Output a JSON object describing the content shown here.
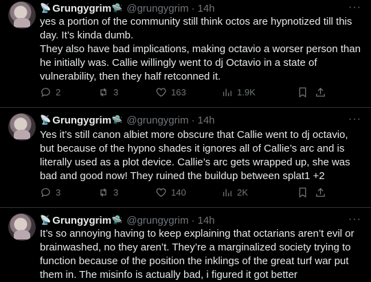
{
  "tweets": [
    {
      "emoji": "📡",
      "name": "Grungygrim",
      "badge": "🛸",
      "handle": "@grungygrim",
      "sep": "·",
      "time": "14h",
      "more": "···",
      "text": "yes a portion of the community still think octos are hypnotized till this day. It’s kinda dumb.\nThey also have bad implications, making octavio a worser person than he initially was. Callie willingly went to dj Octavio in a state of vulnerability, then they half retconned it.",
      "replies": "2",
      "reposts": "3",
      "likes": "163",
      "views": "1.9K"
    },
    {
      "emoji": "📡",
      "name": "Grungygrim",
      "badge": "🛸",
      "handle": "@grungygrim",
      "sep": "·",
      "time": "14h",
      "more": "···",
      "text": "Yes it’s still canon albiet more obscure that Callie went to dj octavio, but because of the hypno shades it ignores all of Callie’s arc and is literally used as a plot device. Callie’s arc gets wrapped up, she was bad and good now! They ruined the buildup between splat1 +2",
      "replies": "3",
      "reposts": "3",
      "likes": "140",
      "views": "2K"
    },
    {
      "emoji": "📡",
      "name": "Grungygrim",
      "badge": "🛸",
      "handle": "@grungygrim",
      "sep": "·",
      "time": "14h",
      "more": "···",
      "text": "It’s so annoying having to keep explaining that octarians aren’t evil or brainwashed, no they aren’t. They’re a marginalized society trying to function because of the position the inklings of the great turf war put them in. The misinfo is actually bad, i figured it got better"
    }
  ]
}
